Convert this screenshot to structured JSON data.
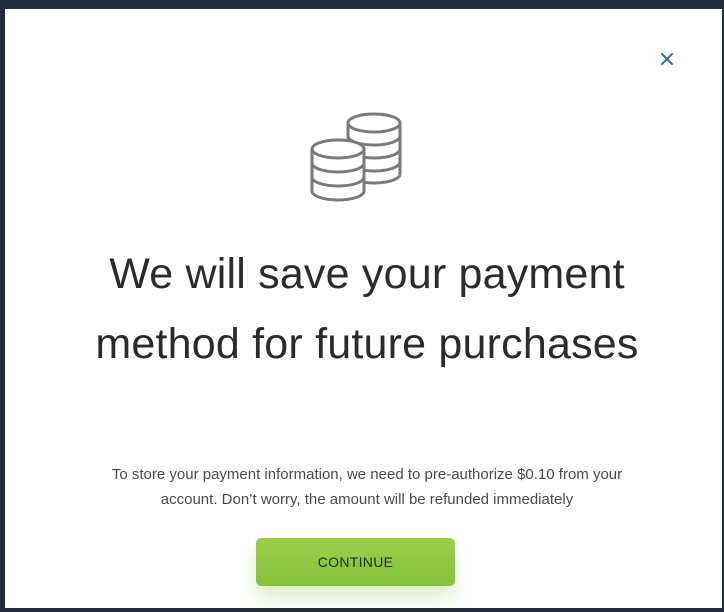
{
  "dialog": {
    "close_icon": "close-icon",
    "illustration_icon": "coins-stack-icon",
    "title": "We will save your payment method for future purchases",
    "description_line1": "To store your payment information, we need to pre-authorize $0.10 from your",
    "description_line2": "account. Don’t worry, the amount will be refunded immediately",
    "continue_label": "CONTINUE"
  },
  "colors": {
    "frame": "#232c3a",
    "close_icon": "#2f6e9e",
    "title_text": "#2b2b2b",
    "body_text": "#4a4a4a",
    "button": "#8cc63f",
    "coin_outline": "#7a7a7a"
  }
}
